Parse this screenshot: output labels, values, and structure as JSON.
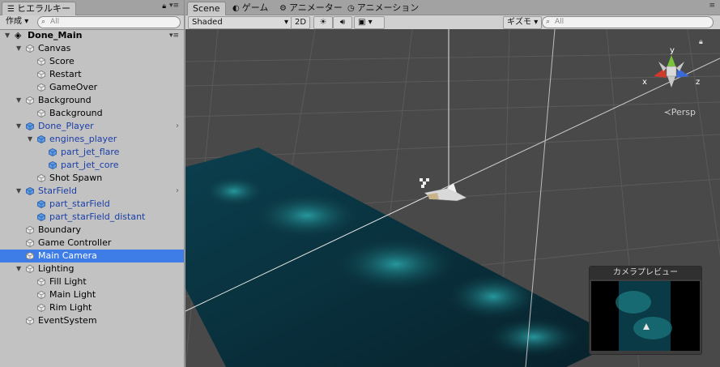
{
  "hierarchy": {
    "tab_label": "ヒエラルキー",
    "create_label": "作成",
    "search_placeholder": "All",
    "scene_name": "Done_Main",
    "items": [
      {
        "label": "Canvas",
        "depth": 1,
        "expandable": true,
        "prefab": false
      },
      {
        "label": "Score",
        "depth": 2,
        "expandable": false,
        "prefab": false
      },
      {
        "label": "Restart",
        "depth": 2,
        "expandable": false,
        "prefab": false
      },
      {
        "label": "GameOver",
        "depth": 2,
        "expandable": false,
        "prefab": false
      },
      {
        "label": "Background",
        "depth": 1,
        "expandable": true,
        "prefab": false
      },
      {
        "label": "Background",
        "depth": 2,
        "expandable": false,
        "prefab": false
      },
      {
        "label": "Done_Player",
        "depth": 1,
        "expandable": true,
        "prefab": true
      },
      {
        "label": "engines_player",
        "depth": 2,
        "expandable": true,
        "prefab": true
      },
      {
        "label": "part_jet_flare",
        "depth": 3,
        "expandable": false,
        "prefab": true
      },
      {
        "label": "part_jet_core",
        "depth": 3,
        "expandable": false,
        "prefab": true
      },
      {
        "label": "Shot Spawn",
        "depth": 2,
        "expandable": false,
        "prefab": false
      },
      {
        "label": "StarField",
        "depth": 1,
        "expandable": true,
        "prefab": true
      },
      {
        "label": "part_starField",
        "depth": 2,
        "expandable": false,
        "prefab": true
      },
      {
        "label": "part_starField_distant",
        "depth": 2,
        "expandable": false,
        "prefab": true
      },
      {
        "label": "Boundary",
        "depth": 1,
        "expandable": false,
        "prefab": false
      },
      {
        "label": "Game Controller",
        "depth": 1,
        "expandable": false,
        "prefab": false
      },
      {
        "label": "Main Camera",
        "depth": 1,
        "expandable": false,
        "prefab": false,
        "selected": true
      },
      {
        "label": "Lighting",
        "depth": 1,
        "expandable": true,
        "prefab": false
      },
      {
        "label": "Fill Light",
        "depth": 2,
        "expandable": false,
        "prefab": false
      },
      {
        "label": "Main Light",
        "depth": 2,
        "expandable": false,
        "prefab": false
      },
      {
        "label": "Rim Light",
        "depth": 2,
        "expandable": false,
        "prefab": false
      },
      {
        "label": "EventSystem",
        "depth": 1,
        "expandable": false,
        "prefab": false
      }
    ]
  },
  "scene": {
    "tabs": [
      {
        "label": "Scene",
        "icon": "scene-icon",
        "active": true
      },
      {
        "label": "ゲーム",
        "icon": "game-icon",
        "active": false
      },
      {
        "label": "アニメーター",
        "icon": "animator-icon",
        "active": false
      },
      {
        "label": "アニメーション",
        "icon": "animation-icon",
        "active": false
      }
    ],
    "shading_mode": "Shaded",
    "mode_2d_label": "2D",
    "gizmos_label": "ギズモ",
    "search_placeholder": "All",
    "axis_labels": {
      "x": "x",
      "y": "y",
      "z": "z"
    },
    "projection_label": "Persp",
    "camera_preview_title": "カメラプレビュー"
  },
  "colors": {
    "selection": "#3e7de7",
    "prefab_text": "#1a3ea8",
    "viewport_bg": "#494949",
    "axis_x": "#d03a2a",
    "axis_y": "#7ac43a",
    "axis_z": "#3a6ad8"
  }
}
